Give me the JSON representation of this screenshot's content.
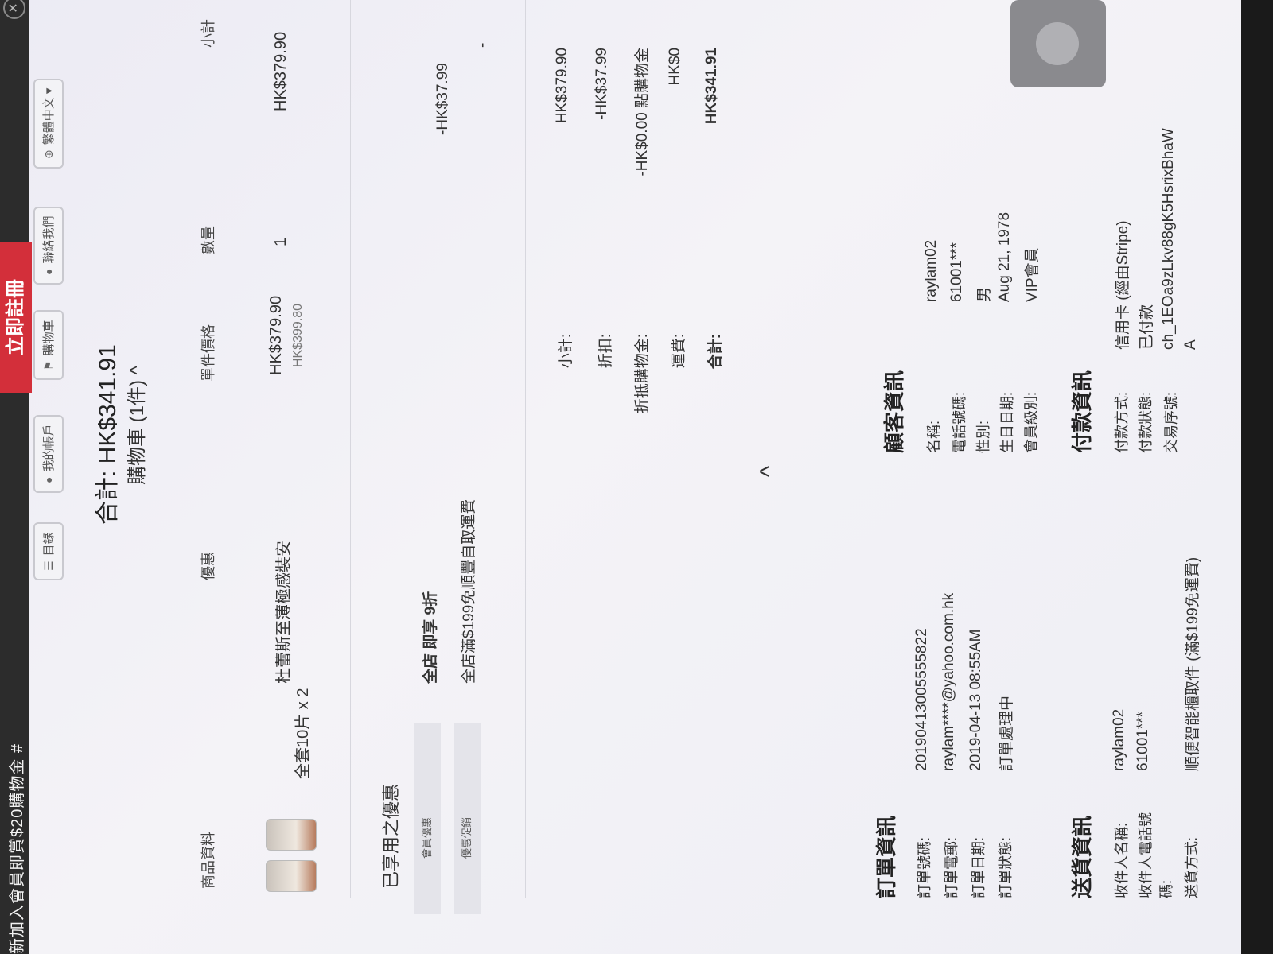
{
  "top_banner": {
    "promo_text": "新加入會員即賞$20購物金 #",
    "signup_button": "立即註冊"
  },
  "nav": {
    "menu": "目錄",
    "account": "我的帳戶",
    "cart": "購物車",
    "contact": "聯絡我們",
    "language": "繁體中文"
  },
  "summary_header": {
    "total": "合計: HK$341.91",
    "cart_count": "購物車 (1件) ^"
  },
  "table": {
    "headers": {
      "product": "商品資料",
      "discount": "優惠",
      "unit_price": "單件價格",
      "qty": "數量",
      "subtotal": "小計"
    },
    "rows": [
      {
        "name_line1": "杜蕾斯至薄極感裝安",
        "name_line2": "全套10片 x 2",
        "price": "HK$379.90",
        "original_price": "HK$399.80",
        "qty": "1",
        "subtotal": "HK$379.90"
      }
    ]
  },
  "offers": {
    "title": "已享用之優惠",
    "items": [
      {
        "tag": "會員優惠",
        "text": "全店 即享 9折",
        "amount": "-HK$37.99"
      },
      {
        "tag": "優惠促銷",
        "text": "全店滿$199免順豐自取運費",
        "amount": "-"
      }
    ]
  },
  "totals": {
    "subtotal_label": "小計:",
    "subtotal_value": "HK$379.90",
    "discount_label": "折扣:",
    "discount_value": "-HK$37.99",
    "credit_label": "折抵購物金:",
    "credit_value": "-HK$0.00 點購物金",
    "shipping_label": "運費:",
    "shipping_value": "HK$0",
    "total_label": "合計:",
    "total_value": "HK$341.91",
    "collapse": "^"
  },
  "order_info": {
    "title": "訂單資訊",
    "number_label": "訂單號碼:",
    "number": "20190413005555822",
    "email_label": "訂單電郵:",
    "email": "raylam****@yahoo.com.hk",
    "date_label": "訂單日期:",
    "date": "2019-04-13 08:55AM",
    "status_label": "訂單狀態:",
    "status": "訂單處理中"
  },
  "customer_info": {
    "title": "顧客資訊",
    "name_label": "名稱:",
    "name": "raylam02",
    "phone_label": "電話號碼:",
    "phone": "61001***",
    "gender_label": "性別:",
    "gender": "男",
    "birthday_label": "生日日期:",
    "birthday": "Aug 21, 1978",
    "level_label": "會員級別:",
    "level": "VIP會員"
  },
  "shipping_info": {
    "title": "送貨資訊",
    "recipient_label": "收件人名稱:",
    "recipient": "raylam02",
    "phone_label": "收件人電話號",
    "phone_label2": "碼:",
    "phone": "61001***",
    "method_label": "送貨方式:",
    "method": "順便智能櫃取件 (滿$199免運費)"
  },
  "payment_info": {
    "title": "付款資訊",
    "method_label": "付款方式:",
    "method": "信用卡 (經由Stripe)",
    "status_label": "付款狀態:",
    "status": "已付款",
    "txn_label": "交易序號:",
    "txn": "ch_1EOa9zLkv88gK5HsrixBhaW",
    "txn2": "A"
  },
  "colors": {
    "brand_red": "#d32f3a",
    "background": "#f1f0f5",
    "text": "#333333"
  }
}
